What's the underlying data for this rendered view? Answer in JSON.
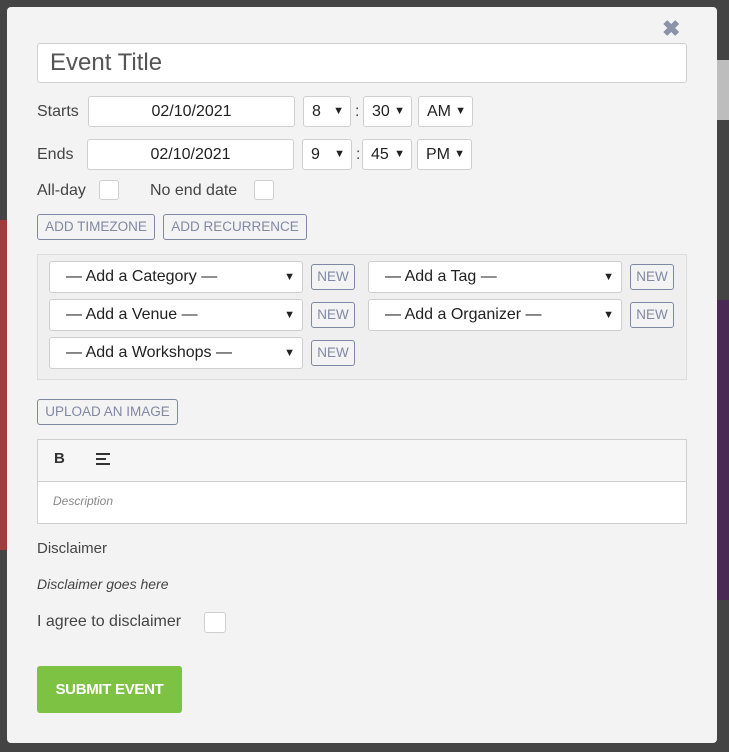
{
  "modal": {
    "close_label": "✖",
    "title_placeholder": "Event Title"
  },
  "starts": {
    "label": "Starts",
    "date": "02/10/2021",
    "hour": "8",
    "minute": "30",
    "ampm": "AM"
  },
  "ends": {
    "label": "Ends",
    "date": "02/10/2021",
    "hour": "9",
    "minute": "45",
    "ampm": "PM"
  },
  "time_separator": ":",
  "options": {
    "allday_label": "All-day",
    "noend_label": "No end date"
  },
  "buttons": {
    "add_timezone": "ADD TIMEZONE",
    "add_recurrence": "ADD RECURRENCE",
    "upload_image": "UPLOAD AN IMAGE",
    "submit": "SUBMIT EVENT",
    "new": "NEW"
  },
  "taxonomies": {
    "category": "— Add a Category —",
    "tag": "— Add a Tag —",
    "venue": "— Add a Venue —",
    "organizer": "— Add a Organizer —",
    "workshops": "— Add a Workshops —"
  },
  "editor": {
    "bold_label": "B",
    "description_placeholder": "Description"
  },
  "disclaimer": {
    "heading": "Disclaimer",
    "text": "Disclaimer goes here",
    "agree_label": "I agree to disclaimer"
  },
  "colors": {
    "submit_green": "#7dc242",
    "outline_button": "#7f88a2",
    "modal_bg": "#f3f3f3"
  }
}
